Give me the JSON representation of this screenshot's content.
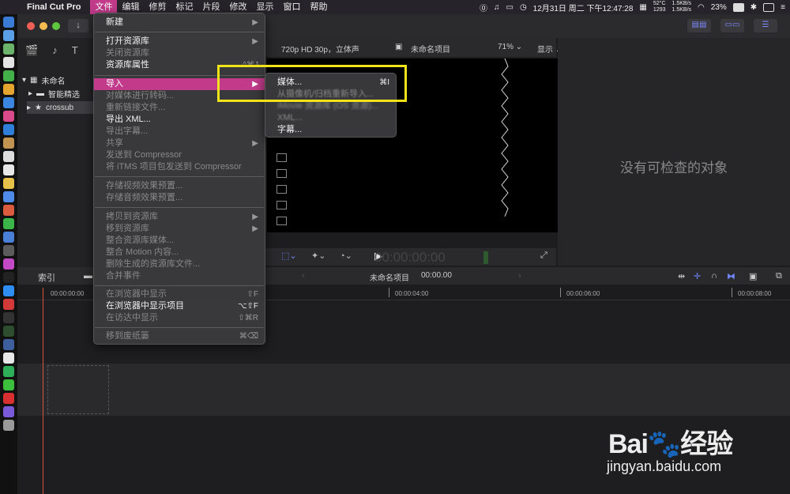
{
  "menubar": {
    "app_name": "Final Cut Pro",
    "menus": [
      "文件",
      "编辑",
      "修剪",
      "标记",
      "片段",
      "修改",
      "显示",
      "窗口",
      "帮助"
    ],
    "active_menu": "文件",
    "cpu_temp": "52°C",
    "fan_rpm": "1293",
    "net_up": "1.5KB/s",
    "net_down": "1.5KB/s",
    "battery": "23%",
    "datetime": "12月31日 周二 下午12:47:28"
  },
  "browser": {
    "library_name": "未命名",
    "smart_collections": "智能精选",
    "event_name": "crossub"
  },
  "viewer": {
    "format": "720p HD 30p，立体声",
    "project": "未命名项目",
    "zoom": "71%",
    "display_menu": "显示",
    "timecode": "00:00:00:00"
  },
  "inspector": {
    "empty_text": "没有可检查的对象"
  },
  "timeline": {
    "index_tab": "索引",
    "project_name": "未命名项目",
    "project_duration": "00:00.00",
    "ruler": [
      "00:00:00:00",
      "00:00:04:00",
      "00:00:06:00",
      "00:00:08:00"
    ]
  },
  "file_menu": {
    "new": "新建",
    "open_library": "打开资源库",
    "close_library": "关闭资源库",
    "library_properties": "资源库属性",
    "library_properties_shortcut": "^⌘J",
    "import": "导入",
    "transcode": "对媒体进行转码...",
    "relink": "重新链接文件...",
    "export_xml": "导出 XML...",
    "export_captions": "导出字幕...",
    "share": "共享",
    "send_compressor": "发送到 Compressor",
    "send_itms": "将 iTMS 项目包发送到 Compressor",
    "save_video_preset": "存储视频效果预置...",
    "save_audio_preset": "存储音频效果预置...",
    "copy_to_library": "拷贝到资源库",
    "move_to_library": "移到资源库",
    "consolidate_media": "整合资源库媒体...",
    "consolidate_motion": "整合 Motion 内容...",
    "delete_generated": "删除生成的资源库文件...",
    "merge_events": "合并事件",
    "reveal_browser": "在浏览器中显示",
    "reveal_browser_shortcut": "⇧F",
    "reveal_project_browser": "在浏览器中显示项目",
    "reveal_project_browser_shortcut": "⌥⇧F",
    "reveal_finder": "在访达中显示",
    "reveal_finder_shortcut": "⇧⌘R",
    "move_to_trash": "移到废纸篓",
    "move_to_trash_shortcut": "⌘⌫"
  },
  "import_submenu": {
    "media": "媒体...",
    "media_shortcut": "⌘I",
    "reimport_camera": "从摄像机/归档重新导入...",
    "imovie_library": "iMovie 资源库 (OS 资源)...",
    "xml": "XML...",
    "captions": "字幕..."
  },
  "watermark": {
    "logo": "Bai🐾经验",
    "url": "jingyan.baidu.com"
  }
}
